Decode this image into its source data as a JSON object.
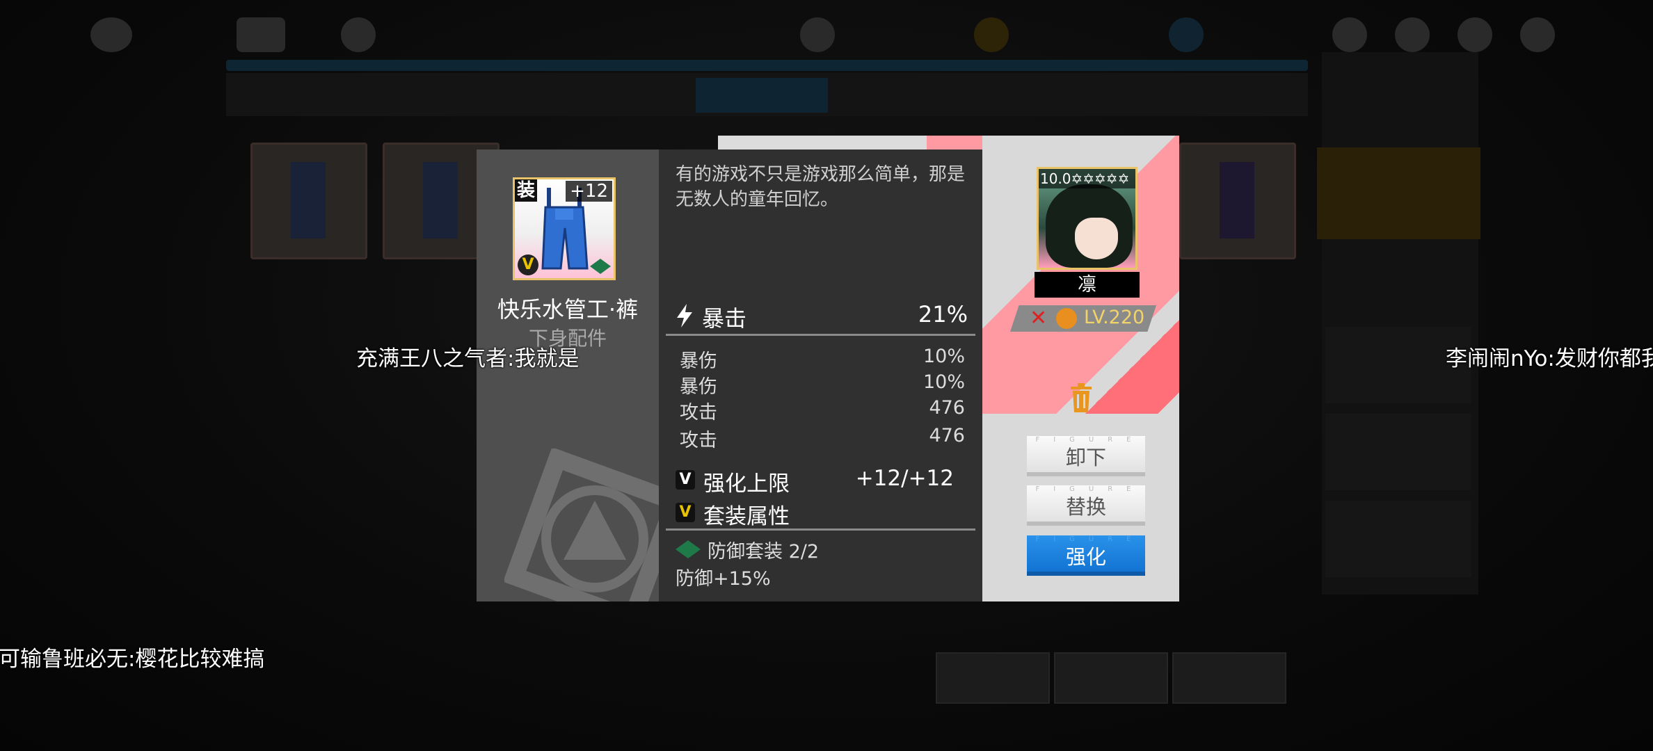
{
  "modal": {
    "item": {
      "equip_tag": "装",
      "enhance_level": "+12",
      "v_badge": "V",
      "name": "快乐水管工·裤",
      "slot": "下身配件"
    },
    "description": "有的游戏不只是游戏那么简单，那是无数人的童年回忆。",
    "main_stat": {
      "name": "暴击",
      "value": "21%",
      "icon": "lightning-icon"
    },
    "sub_stats": [
      {
        "name": "暴伤",
        "value": "10%"
      },
      {
        "name": "暴伤",
        "value": "10%"
      },
      {
        "name": "攻击",
        "value": "476"
      },
      {
        "name": "攻击",
        "value": "476"
      }
    ],
    "enhance_cap": {
      "badge": "V",
      "label": "强化上限",
      "value": "+12/+12"
    },
    "set_attr": {
      "badge": "V",
      "label": "套装属性"
    },
    "set_bonus": {
      "name": "防御套装 2/2",
      "effect": "防御+15%",
      "icon": "defense-set-icon"
    },
    "character": {
      "rating": "10.0✡✡✡✡✡",
      "name": "凛",
      "level": "LV.220"
    },
    "buttons": {
      "unequip": "卸下",
      "replace": "替换",
      "enhance": "强化",
      "figure_text": "FIGURE"
    },
    "colors": {
      "accent_blue": "#1a82e0",
      "stripe_pink": "#ff9aa3",
      "gold": "#e8c36a"
    }
  },
  "danmaku": [
    "充满王八之气者:我就是",
    "李闹闹nYo:发财你都我",
    "可输鲁班必无:樱花比较难搞"
  ]
}
